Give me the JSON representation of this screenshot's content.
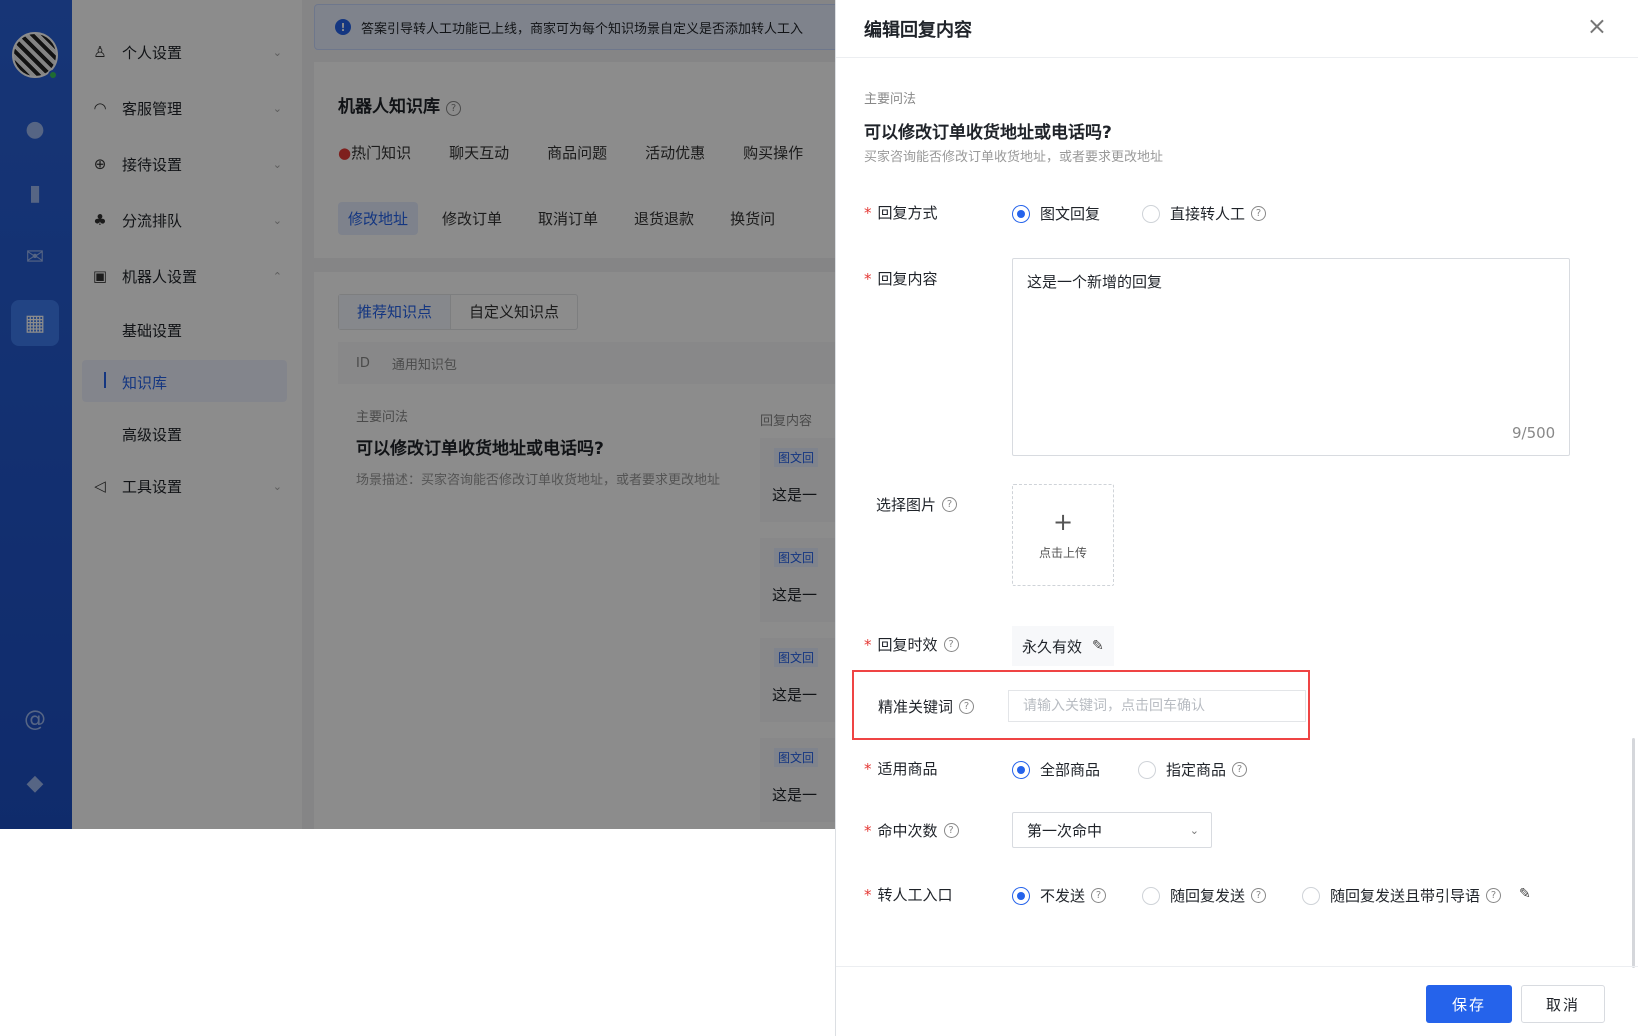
{
  "notice": {
    "text": "答案引导转人工功能已上线，商家可为每个知识场景自定义是否添加转人工入"
  },
  "menu": {
    "items": [
      {
        "label": "个人设置",
        "icon": "user-icon"
      },
      {
        "label": "客服管理",
        "icon": "headset-icon"
      },
      {
        "label": "接待设置",
        "icon": "download-circle-icon"
      },
      {
        "label": "分流排队",
        "icon": "org-chart-icon"
      },
      {
        "label": "机器人设置",
        "icon": "robot-icon"
      },
      {
        "label": "工具设置",
        "icon": "send-icon"
      }
    ],
    "subitems": [
      "基础设置",
      "知识库",
      "高级设置"
    ]
  },
  "kb": {
    "title": "机器人知识库",
    "categories": [
      "热门知识",
      "聊天互动",
      "商品问题",
      "活动优惠",
      "购买操作"
    ],
    "subcategories": [
      "修改地址",
      "修改订单",
      "取消订单",
      "退货退款",
      "换货问"
    ],
    "segments": [
      "推荐知识点",
      "自定义知识点"
    ],
    "table_head": [
      "ID",
      "通用知识包"
    ],
    "row_label": "主要问法",
    "row_question": "可以修改订单收货地址或电话吗?",
    "row_desc": "场景描述：买家咨询能否修改订单收货地址，或者要求更改地址",
    "reply_col": "回复内容",
    "reply_tag": "图文回",
    "reply_text": "这是一"
  },
  "drawer": {
    "title": "编辑回复内容",
    "close_icon": "close-icon",
    "main_q_label": "主要问法",
    "question": "可以修改订单收货地址或电话吗?",
    "question_desc": "买家咨询能否修改订单收货地址，或者要求更改地址",
    "reply_method": {
      "label": "回复方式",
      "options": [
        "图文回复",
        "直接转人工"
      ],
      "selected": "图文回复"
    },
    "reply_content": {
      "label": "回复内容",
      "value": "这是一个新增的回复",
      "count": "9/500"
    },
    "image": {
      "label": "选择图片",
      "upload_text": "点击上传"
    },
    "validity": {
      "label": "回复时效",
      "value": "永久有效"
    },
    "keywords": {
      "label": "精准关键词",
      "placeholder": "请输入关键词，点击回车确认"
    },
    "goods": {
      "label": "适用商品",
      "options": [
        "全部商品",
        "指定商品"
      ],
      "selected": "全部商品"
    },
    "hit_count": {
      "label": "命中次数",
      "value": "第一次命中"
    },
    "human_entry": {
      "label": "转人工入口",
      "options": [
        "不发送",
        "随回复发送",
        "随回复发送且带引导语"
      ],
      "selected": "不发送"
    },
    "save_label": "保存",
    "cancel_label": "取消"
  },
  "colors": {
    "primary": "#2563eb",
    "highlight_border": "#ef4444",
    "rail": "#2a62d8"
  }
}
